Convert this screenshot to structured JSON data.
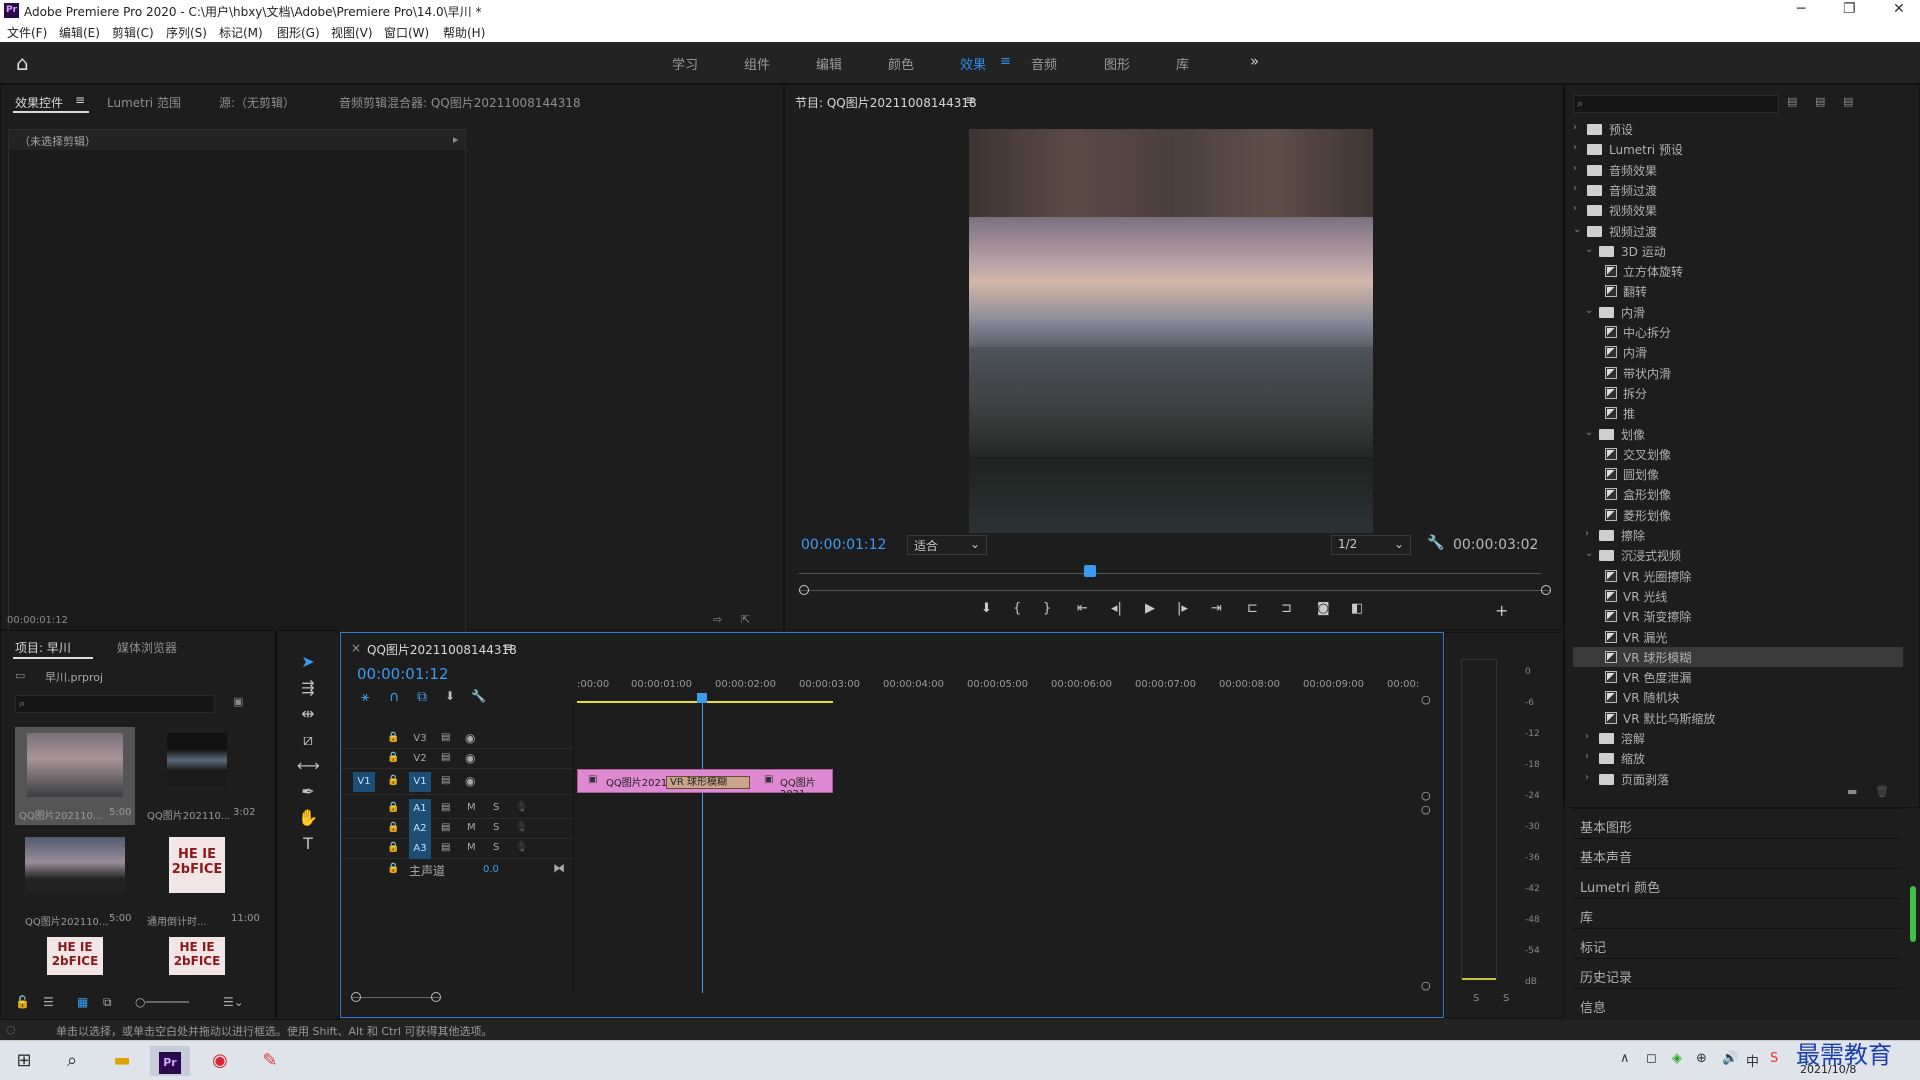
{
  "window": {
    "title": "Adobe Premiere Pro 2020 - C:\\用户\\hbxy\\文档\\Adobe\\Premiere Pro\\14.0\\早川 *",
    "min": "─",
    "max": "❐",
    "close": "✕"
  },
  "menu": [
    "文件(F)",
    "编辑(E)",
    "剪辑(C)",
    "序列(S)",
    "标记(M)",
    "图形(G)",
    "视图(V)",
    "窗口(W)",
    "帮助(H)"
  ],
  "workspaces": {
    "items": [
      "学习",
      "组件",
      "编辑",
      "颜色",
      "效果",
      "音频",
      "图形",
      "库"
    ],
    "active": "效果",
    "more": "»"
  },
  "effect_controls": {
    "tabs": [
      "效果控件",
      "Lumetri 范围",
      "源:（无剪辑）",
      "音频剪辑混合器: QQ图片20211008144318"
    ],
    "no_clip": "（未选择剪辑）",
    "timecode": "00:00:01:12"
  },
  "program": {
    "title": "节目: QQ图片20211008144318",
    "timecode": "00:00:01:12",
    "fit": "适合",
    "resolution": "1/2",
    "duration": "00:00:03:02"
  },
  "project": {
    "tabs": [
      "项目: 早川",
      "媒体浏览器"
    ],
    "file": "早川.prproj",
    "items": [
      {
        "name": "QQ图片2021​10...",
        "dur": "5:00"
      },
      {
        "name": "QQ图片202110...",
        "dur": "3:02"
      },
      {
        "name": "QQ图片202110...",
        "dur": "5:00"
      },
      {
        "name": "通用倒计时...",
        "dur": "11:00"
      }
    ],
    "logo_text": "HE IE\n2bFICE"
  },
  "timeline": {
    "tab": "QQ图片20211008144318",
    "timecode": "00:00:01:12",
    "ruler": [
      ":00:00",
      "00:00:01:00",
      "00:00:02:00",
      "00:00:03:00",
      "00:00:04:00",
      "00:00:05:00",
      "00:00:06:00",
      "00:00:07:00",
      "00:00:08:00",
      "00:00:09:00",
      "00:00:"
    ],
    "tracks_video": [
      "V3",
      "V2",
      "V1"
    ],
    "tracks_audio": [
      "A1",
      "A2",
      "A3"
    ],
    "source_patch": "V1",
    "mute": "M",
    "solo": "S",
    "master": "主声道",
    "master_val": "0.0",
    "clip_a": "QQ图片2021",
    "clip_b": "QQ图片2021",
    "transition": "VR 球形模糊"
  },
  "meter": {
    "scale": [
      "0",
      "-6",
      "-12",
      "-18",
      "-24",
      "-30",
      "-36",
      "-42",
      "-48",
      "-54",
      "dB"
    ],
    "solo": [
      "S",
      "S"
    ]
  },
  "effects": {
    "tree": [
      {
        "level": 0,
        "type": "folder",
        "label": "预设",
        "open": false
      },
      {
        "level": 0,
        "type": "folder",
        "label": "Lumetri 预设",
        "open": false
      },
      {
        "level": 0,
        "type": "folder",
        "label": "音频效果",
        "open": false
      },
      {
        "level": 0,
        "type": "folder",
        "label": "音频过渡",
        "open": false
      },
      {
        "level": 0,
        "type": "folder",
        "label": "视频效果",
        "open": false
      },
      {
        "level": 0,
        "type": "folder",
        "label": "视频过渡",
        "open": true
      },
      {
        "level": 1,
        "type": "folder",
        "label": "3D 运动",
        "open": true
      },
      {
        "level": 2,
        "type": "fx",
        "label": "立方体旋转"
      },
      {
        "level": 2,
        "type": "fx",
        "label": "翻转"
      },
      {
        "level": 1,
        "type": "folder",
        "label": "内滑",
        "open": true
      },
      {
        "level": 2,
        "type": "fx",
        "label": "中心拆分"
      },
      {
        "level": 2,
        "type": "fx",
        "label": "内滑"
      },
      {
        "level": 2,
        "type": "fx",
        "label": "带状内滑"
      },
      {
        "level": 2,
        "type": "fx",
        "label": "拆分"
      },
      {
        "level": 2,
        "type": "fx",
        "label": "推"
      },
      {
        "level": 1,
        "type": "folder",
        "label": "划像",
        "open": true
      },
      {
        "level": 2,
        "type": "fx",
        "label": "交叉划像"
      },
      {
        "level": 2,
        "type": "fx",
        "label": "圆划像"
      },
      {
        "level": 2,
        "type": "fx",
        "label": "盒形划像"
      },
      {
        "level": 2,
        "type": "fx",
        "label": "菱形划像"
      },
      {
        "level": 1,
        "type": "folder",
        "label": "擦除",
        "open": false
      },
      {
        "level": 1,
        "type": "folder",
        "label": "沉浸式视频",
        "open": true
      },
      {
        "level": 2,
        "type": "fx",
        "label": "VR 光圈擦除"
      },
      {
        "level": 2,
        "type": "fx",
        "label": "VR 光线"
      },
      {
        "level": 2,
        "type": "fx",
        "label": "VR 渐变擦除"
      },
      {
        "level": 2,
        "type": "fx",
        "label": "VR 漏光"
      },
      {
        "level": 2,
        "type": "fx",
        "label": "VR 球形模糊",
        "selected": true
      },
      {
        "level": 2,
        "type": "fx",
        "label": "VR 色度泄漏"
      },
      {
        "level": 2,
        "type": "fx",
        "label": "VR 随机块"
      },
      {
        "level": 2,
        "type": "fx",
        "label": "VR 默比乌斯缩放"
      },
      {
        "level": 1,
        "type": "folder",
        "label": "溶解",
        "open": false
      },
      {
        "level": 1,
        "type": "folder",
        "label": "缩放",
        "open": false
      },
      {
        "level": 1,
        "type": "folder",
        "label": "页面剥落",
        "open": false
      }
    ],
    "sections": [
      "基本图形",
      "基本声音",
      "Lumetri 颜色",
      "库",
      "标记",
      "历史记录",
      "信息"
    ]
  },
  "status": "单击以选择，或单击空白处并拖动以进行框选。使用 Shift、Alt 和 Ctrl 可获得其他选项。",
  "taskbar": {
    "date": "2021/10/8",
    "ime": "中",
    "watermark": "最需教育"
  }
}
